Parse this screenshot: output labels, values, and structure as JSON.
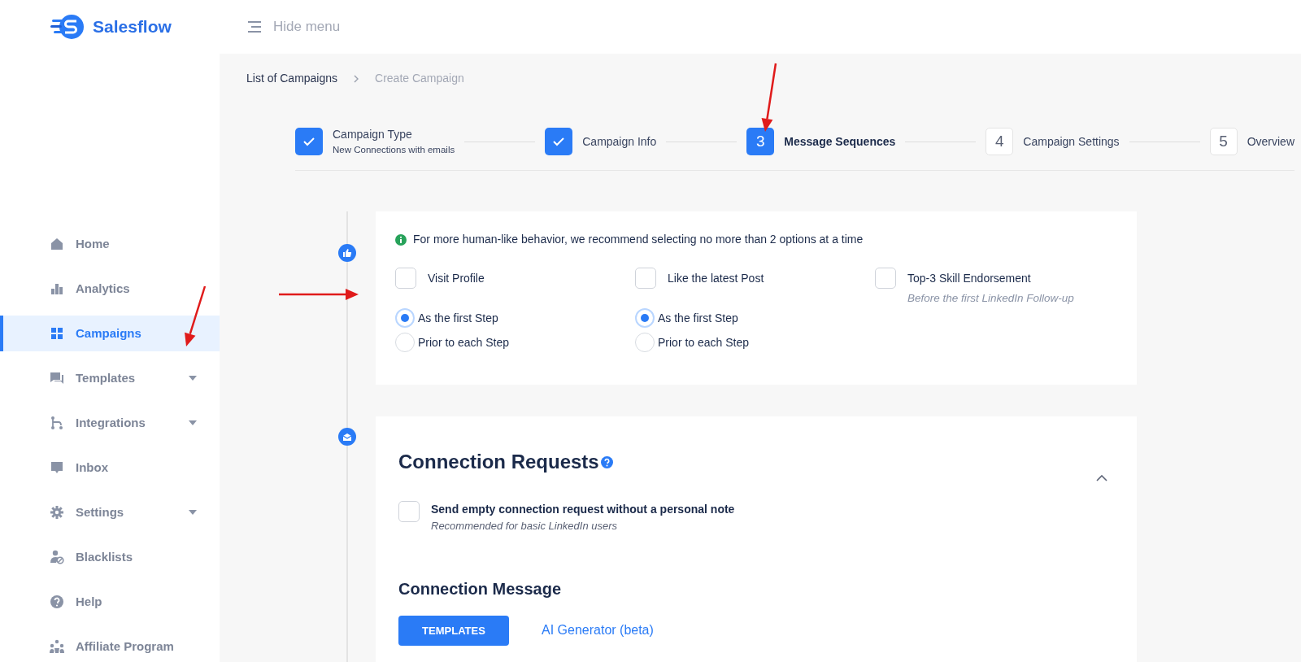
{
  "brand": {
    "name": "Salesflow"
  },
  "topbar": {
    "toggle_label": "Hide menu"
  },
  "sidebar": {
    "items": [
      {
        "label": "Home",
        "selected": false,
        "has_submenu": false
      },
      {
        "label": "Analytics",
        "selected": false,
        "has_submenu": false
      },
      {
        "label": "Campaigns",
        "selected": true,
        "has_submenu": false
      },
      {
        "label": "Templates",
        "selected": false,
        "has_submenu": true
      },
      {
        "label": "Integrations",
        "selected": false,
        "has_submenu": true
      },
      {
        "label": "Inbox",
        "selected": false,
        "has_submenu": false
      },
      {
        "label": "Settings",
        "selected": false,
        "has_submenu": true
      },
      {
        "label": "Blacklists",
        "selected": false,
        "has_submenu": false
      },
      {
        "label": "Help",
        "selected": false,
        "has_submenu": false
      },
      {
        "label": "Affiliate Program",
        "selected": false,
        "has_submenu": false
      }
    ]
  },
  "breadcrumb": [
    {
      "label": "List of Campaigns",
      "kind": "link"
    },
    {
      "label": "Create Campaign",
      "kind": "current"
    }
  ],
  "stepper": {
    "steps": [
      {
        "title": "Campaign Type",
        "subtitle": "New Connections with emails",
        "completed": true,
        "current": false
      },
      {
        "title": "Campaign Info",
        "completed": true,
        "current": false
      },
      {
        "number": "3",
        "title": "Message Sequences",
        "completed": false,
        "current": true
      },
      {
        "number": "4",
        "title": "Campaign Settings",
        "completed": false,
        "current": false
      },
      {
        "number": "5",
        "title": "Overview",
        "completed": false,
        "current": false
      }
    ]
  },
  "actions_card": {
    "notice": "For more human-like behavior, we recommend selecting no more than 2 options at a time",
    "options": [
      {
        "label": "Visit Profile",
        "checked": false,
        "radios": [
          {
            "label": "As the first Step",
            "selected": true
          },
          {
            "label": "Prior to each Step",
            "selected": false
          }
        ]
      },
      {
        "label": "Like the latest Post",
        "checked": false,
        "radios": [
          {
            "label": "As the first Step",
            "selected": true
          },
          {
            "label": "Prior to each Step",
            "selected": false
          }
        ]
      },
      {
        "label": "Top-3 Skill Endorsement",
        "checked": false,
        "hint": "Before the first LinkedIn Follow-up"
      }
    ]
  },
  "connection_card": {
    "title": "Connection Requests",
    "expanded": true,
    "checkbox": {
      "label": "Send empty connection request without a personal note",
      "hint": "Recommended for basic LinkedIn users",
      "checked": false
    },
    "message_title": "Connection Message",
    "button": "TEMPLATES",
    "link": "AI Generator (beta)"
  }
}
